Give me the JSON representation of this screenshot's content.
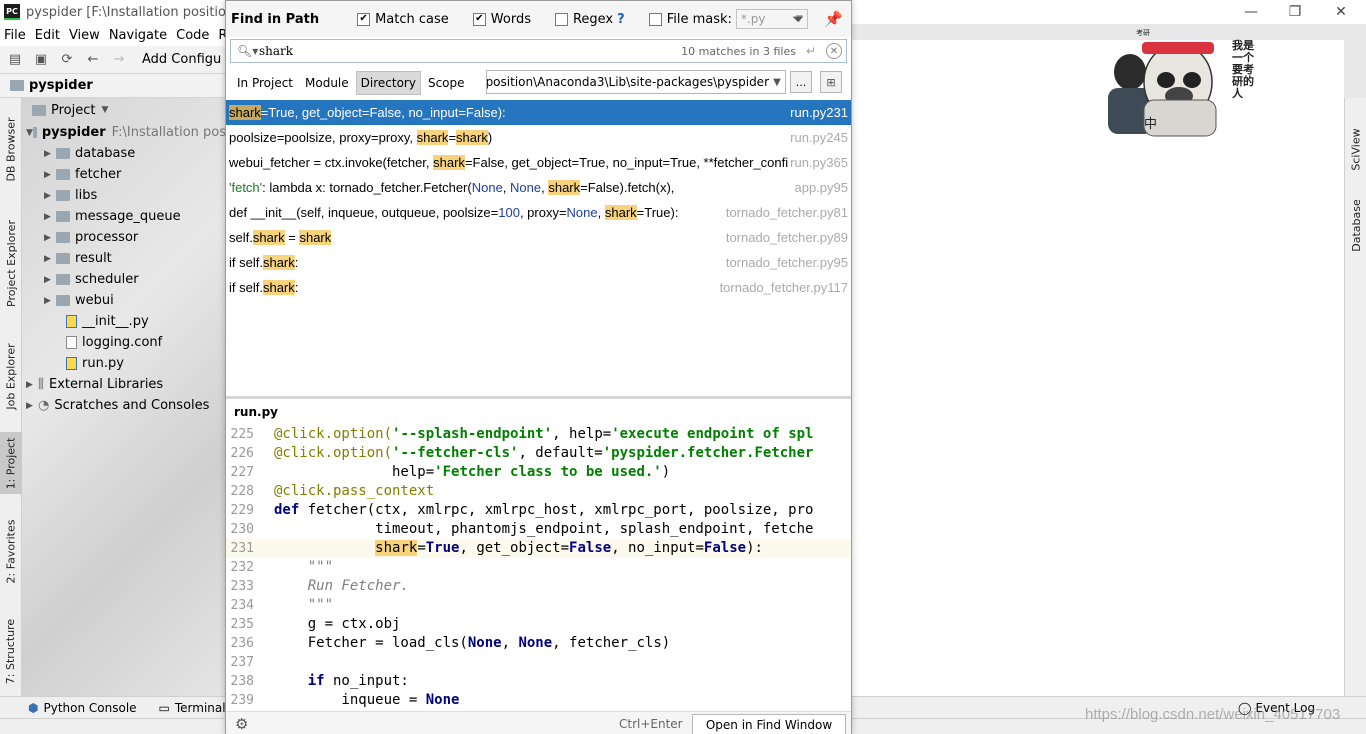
{
  "window": {
    "title": "pyspider [F:\\Installation position\\A",
    "logo": "PC",
    "controls": [
      "—",
      "❐",
      "✕"
    ]
  },
  "menu": [
    "File",
    "Edit",
    "View",
    "Navigate",
    "Code",
    "R"
  ],
  "toolbar": {
    "add_config": "Add Configu"
  },
  "breadcrumb": "pyspider",
  "left_tabs": [
    "DB Browser",
    "Project Explorer",
    "Job Explorer",
    "1: Project",
    "2: Favorites",
    "7: Structure"
  ],
  "right_tabs": [
    "SciView",
    "Database"
  ],
  "project": {
    "header": "Project",
    "root_name": "pyspider",
    "root_path": "F:\\Installation pos",
    "folders": [
      "database",
      "fetcher",
      "libs",
      "message_queue",
      "processor",
      "result",
      "scheduler",
      "webui"
    ],
    "files": [
      "__init__.py",
      "logging.conf",
      "run.py"
    ],
    "extra": [
      "External Libraries",
      "Scratches and Consoles"
    ]
  },
  "bottom": {
    "python_console": "Python Console",
    "terminal": "Terminal",
    "event_log": "Event Log"
  },
  "watermark": "https://blog.csdn.net/weixin_40517703",
  "mascot": {
    "caption": "我是一个要考研的人",
    "badge": "中",
    "sign": "考研",
    "colors": {
      "band": "#d9333f",
      "shirt": "#3f4a57"
    }
  },
  "find": {
    "title": "Find in Path",
    "match_case_label": "Match case",
    "words_label": "Words",
    "regex_label": "Regex",
    "regex_help": "?",
    "file_mask_label": "File mask:",
    "file_mask_value": "*.py",
    "match_case": true,
    "words": true,
    "regex": false,
    "file_mask": false,
    "query": "shark",
    "match_count": "10 matches in 3 files",
    "scopes": [
      "In Project",
      "Module",
      "Directory",
      "Scope"
    ],
    "active_scope": "Directory",
    "path": "F:\\Installation position\\Anaconda3\\Lib\\site-packages\\pyspider",
    "browse_label": "...",
    "accent": "#2675bf",
    "highlight": "#f6d37c"
  },
  "results": [
    {
      "segments": [
        {
          "t": "shark",
          "h": true
        },
        {
          "t": "=True, get_object=False, no_input=False):"
        }
      ],
      "file": "run.py",
      "line": "231",
      "selected": true
    },
    {
      "segments": [
        {
          "t": "poolsize=poolsize, proxy=proxy, "
        },
        {
          "t": "shark",
          "h": true
        },
        {
          "t": "="
        },
        {
          "t": "shark",
          "h": true
        },
        {
          "t": ")"
        }
      ],
      "file": "run.py",
      "line": "245"
    },
    {
      "segments": [
        {
          "t": "webui_fetcher = ctx.invoke(fetcher, "
        },
        {
          "t": "shark",
          "h": true
        },
        {
          "t": "=False, get_object=True, no_input=True, **fetcher_confi"
        }
      ],
      "file": "run.py",
      "line": "365"
    },
    {
      "segments": [
        {
          "t": "'fetch'",
          "c": "str"
        },
        {
          "t": ": lambda x: tornado_fetcher.Fetcher("
        },
        {
          "t": "None",
          "c": "none"
        },
        {
          "t": ", "
        },
        {
          "t": "None",
          "c": "none"
        },
        {
          "t": ", "
        },
        {
          "t": "shark",
          "h": true
        },
        {
          "t": "=False).fetch(x),"
        }
      ],
      "file": "app.py",
      "line": "95"
    },
    {
      "segments": [
        {
          "t": "def __init__(self, inqueue, outqueue, poolsize="
        },
        {
          "t": "100",
          "c": "none"
        },
        {
          "t": ", proxy="
        },
        {
          "t": "None",
          "c": "none"
        },
        {
          "t": ", "
        },
        {
          "t": "shark",
          "h": true
        },
        {
          "t": "=True):"
        }
      ],
      "file": "tornado_fetcher.py",
      "line": "81"
    },
    {
      "segments": [
        {
          "t": "self."
        },
        {
          "t": "shark",
          "h": true
        },
        {
          "t": " = "
        },
        {
          "t": "shark",
          "h": true
        }
      ],
      "file": "tornado_fetcher.py",
      "line": "89"
    },
    {
      "segments": [
        {
          "t": "if self."
        },
        {
          "t": "shark",
          "h": true
        },
        {
          "t": ":"
        }
      ],
      "file": "tornado_fetcher.py",
      "line": "95"
    },
    {
      "segments": [
        {
          "t": "if self."
        },
        {
          "t": "shark",
          "h": true
        },
        {
          "t": ":"
        }
      ],
      "file": "tornado_fetcher.py",
      "line": "117"
    }
  ],
  "preview": {
    "file": "run.py",
    "lines": [
      {
        "n": "225",
        "segs": [
          {
            "t": "@click.option(",
            "c": "dec"
          },
          {
            "t": "'--splash-endpoint'",
            "c": "str"
          },
          {
            "t": ", help="
          },
          {
            "t": "'execute endpoint of spl",
            "c": "str"
          }
        ]
      },
      {
        "n": "226",
        "segs": [
          {
            "t": "@click.option(",
            "c": "dec"
          },
          {
            "t": "'--fetcher-cls'",
            "c": "str"
          },
          {
            "t": ", default="
          },
          {
            "t": "'pyspider.fetcher.Fetcher",
            "c": "str"
          }
        ]
      },
      {
        "n": "227",
        "segs": [
          {
            "t": "              help="
          },
          {
            "t": "'Fetcher class to be used.'",
            "c": "str"
          },
          {
            "t": ")"
          }
        ]
      },
      {
        "n": "228",
        "segs": [
          {
            "t": "@click.pass_context",
            "c": "dec"
          }
        ]
      },
      {
        "n": "229",
        "segs": [
          {
            "t": "def",
            "c": "kw"
          },
          {
            "t": " fetcher(ctx, xmlrpc, xmlrpc_host, xmlrpc_port, poolsize, pro"
          }
        ]
      },
      {
        "n": "230",
        "segs": [
          {
            "t": "            timeout, phantomjs_endpoint, splash_endpoint, fetche"
          }
        ]
      },
      {
        "n": "231",
        "current": true,
        "segs": [
          {
            "t": "            "
          },
          {
            "t": "shark",
            "h": true
          },
          {
            "t": "="
          },
          {
            "t": "True",
            "c": "kw"
          },
          {
            "t": ", get_object="
          },
          {
            "t": "False",
            "c": "kw"
          },
          {
            "t": ", no_input="
          },
          {
            "t": "False",
            "c": "kw"
          },
          {
            "t": "):"
          }
        ]
      },
      {
        "n": "232",
        "segs": [
          {
            "t": "    \"\"\"",
            "c": "doc"
          }
        ]
      },
      {
        "n": "233",
        "segs": [
          {
            "t": "    Run Fetcher.",
            "c": "doc"
          }
        ]
      },
      {
        "n": "234",
        "segs": [
          {
            "t": "    \"\"\"",
            "c": "doc"
          }
        ]
      },
      {
        "n": "235",
        "segs": [
          {
            "t": "    g = ctx.obj"
          }
        ]
      },
      {
        "n": "236",
        "segs": [
          {
            "t": "    Fetcher = load_cls("
          },
          {
            "t": "None",
            "c": "kw"
          },
          {
            "t": ", "
          },
          {
            "t": "None",
            "c": "kw"
          },
          {
            "t": ", fetcher_cls)"
          }
        ]
      },
      {
        "n": "237",
        "segs": [
          {
            "t": ""
          }
        ]
      },
      {
        "n": "238",
        "segs": [
          {
            "t": "    "
          },
          {
            "t": "if",
            "c": "kw"
          },
          {
            "t": " no_input:"
          }
        ]
      },
      {
        "n": "239",
        "segs": [
          {
            "t": "        inqueue = "
          },
          {
            "t": "None",
            "c": "kw"
          }
        ]
      }
    ]
  },
  "footer": {
    "shortcut": "Ctrl+Enter",
    "open_button": "Open in Find Window"
  }
}
